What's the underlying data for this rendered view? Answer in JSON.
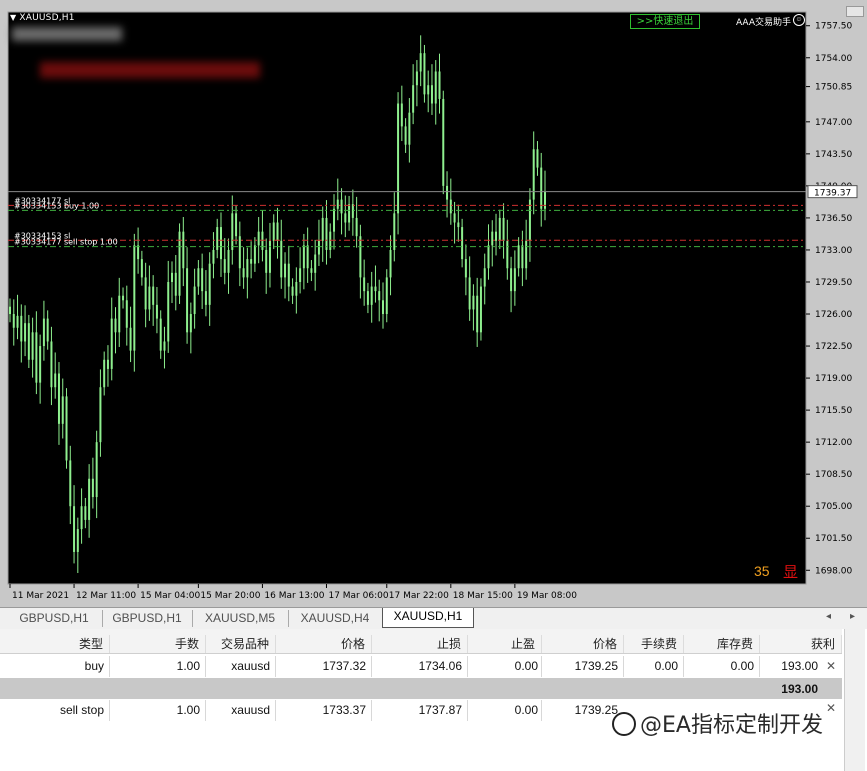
{
  "chart_window": {
    "symbol_title": "XAUUSD,H1",
    "quick_exit_label": ">>快速退出",
    "ea_name": "AAA交易助手",
    "countdown": "35",
    "show_button": "显",
    "current_price_label": "1739.37",
    "order_labels": {
      "sl_buy_a": "#30334177 sl",
      "buy_line": "#30334153 buy 1.00",
      "sl_buy_b": "#30334153 sl",
      "sellstop_line": "#30334177 sell stop 1.00"
    },
    "colors": {
      "background": "#000000",
      "candles": "#8ff08f",
      "order_line_red": "#d03030",
      "order_line_green": "#3fae3f",
      "price_line": "#8a8a8a"
    }
  },
  "chart_data": {
    "type": "candlestick",
    "symbol": "XAUUSD",
    "timeframe": "H1",
    "ylim": [
      1696.5,
      1759.0
    ],
    "y_ticks": [
      1757.5,
      1754.0,
      1750.85,
      1747.0,
      1743.5,
      1740.0,
      1736.5,
      1733.0,
      1729.5,
      1726.0,
      1722.5,
      1719.0,
      1715.5,
      1712.0,
      1708.5,
      1705.0,
      1701.5,
      1698.0
    ],
    "y_tick_labels": [
      "1757.50",
      "1754.00",
      "1750.85",
      "1747.00",
      "1743.50",
      "1740.00",
      "1736.50",
      "1733.00",
      "1729.50",
      "1726.00",
      "1722.50",
      "1719.00",
      "1715.50",
      "1712.00",
      "1708.50",
      "1705.00",
      "1701.50",
      "1698.00"
    ],
    "x_tick_labels": [
      "11 Mar 2021",
      "12 Mar 11:00",
      "15 Mar 04:00",
      "15 Mar 20:00",
      "16 Mar 13:00",
      "17 Mar 06:00",
      "17 Mar 22:00",
      "18 Mar 15:00",
      "19 Mar 08:00"
    ],
    "x_tick_index": [
      0,
      17,
      34,
      50,
      67,
      84,
      100,
      117,
      134
    ],
    "price_line": 1739.37,
    "horizontal_lines": [
      {
        "label": "#30334177 sl",
        "price": 1737.87,
        "color": "red"
      },
      {
        "label": "#30334153 buy 1.00",
        "price": 1737.32,
        "color": "green"
      },
      {
        "label": "#30334153 sl",
        "price": 1734.06,
        "color": "red"
      },
      {
        "label": "#30334177 sell stop 1.00",
        "price": 1733.37,
        "color": "green"
      }
    ],
    "closes": [
      1726.0,
      1724.5,
      1725.8,
      1723.0,
      1725.0,
      1721.0,
      1724.0,
      1718.5,
      1722.5,
      1725.5,
      1723.0,
      1718.0,
      1719.5,
      1714.0,
      1717.0,
      1710.0,
      1705.0,
      1700.0,
      1702.5,
      1705.0,
      1703.5,
      1708.0,
      1706.0,
      1712.0,
      1718.0,
      1721.0,
      1720.0,
      1725.5,
      1724.0,
      1728.0,
      1727.5,
      1724.5,
      1722.0,
      1733.5,
      1732.0,
      1730.0,
      1726.5,
      1729.0,
      1727.0,
      1725.5,
      1722.0,
      1723.0,
      1729.5,
      1730.5,
      1728.0,
      1735.0,
      1731.0,
      1724.0,
      1726.0,
      1729.0,
      1731.0,
      1728.5,
      1727.0,
      1731.5,
      1733.0,
      1735.5,
      1732.0,
      1730.5,
      1733.0,
      1737.0,
      1734.5,
      1731.0,
      1730.0,
      1732.0,
      1731.5,
      1733.5,
      1735.0,
      1733.0,
      1730.5,
      1734.0,
      1736.0,
      1734.0,
      1730.0,
      1731.5,
      1729.0,
      1728.0,
      1729.5,
      1731.0,
      1733.5,
      1731.0,
      1730.5,
      1732.5,
      1734.0,
      1736.5,
      1733.0,
      1735.0,
      1737.5,
      1738.5,
      1737.0,
      1736.0,
      1738.0,
      1736.5,
      1734.5,
      1730.0,
      1728.5,
      1727.0,
      1729.0,
      1728.5,
      1727.5,
      1726.0,
      1730.0,
      1733.0,
      1737.0,
      1749.0,
      1746.5,
      1744.5,
      1748.0,
      1751.0,
      1752.5,
      1754.5,
      1750.0,
      1751.0,
      1749.0,
      1752.5,
      1749.5,
      1740.0,
      1738.5,
      1737.0,
      1736.0,
      1735.5,
      1732.0,
      1730.0,
      1726.5,
      1728.0,
      1724.0,
      1729.0,
      1731.0,
      1733.5,
      1735.0,
      1734.0,
      1736.5,
      1734.0,
      1731.0,
      1728.5,
      1731.0,
      1733.5,
      1731.0,
      1734.0,
      1738.5,
      1744.0,
      1742.0,
      1737.5,
      1739.37
    ]
  },
  "tabs": [
    "GBPUSD,H1",
    "GBPUSD,H1",
    "XAUUSD,M5",
    "XAUUSD,H4",
    "XAUUSD,H1"
  ],
  "active_tab": "XAUUSD,H1",
  "table": {
    "headers": [
      "类型",
      "手数",
      "交易品种",
      "价格",
      "止损",
      "止盈",
      "价格",
      "手续费",
      "库存费",
      "获利"
    ],
    "rows": [
      {
        "type": "buy",
        "lots": "1.00",
        "symbol": "xauusd",
        "price": "1737.32",
        "sl": "1734.06",
        "tp": "0.00",
        "cur_price": "1739.25",
        "commission": "0.00",
        "swap": "0.00",
        "profit": "193.00"
      },
      {
        "type": "sell stop",
        "lots": "1.00",
        "symbol": "xauusd",
        "price": "1733.37",
        "sl": "1737.87",
        "tp": "0.00",
        "cur_price": "1739.25",
        "commission": "",
        "swap": "",
        "profit": ""
      }
    ],
    "total_profit": "193.00"
  },
  "watermark": "@EA指标定制开发"
}
